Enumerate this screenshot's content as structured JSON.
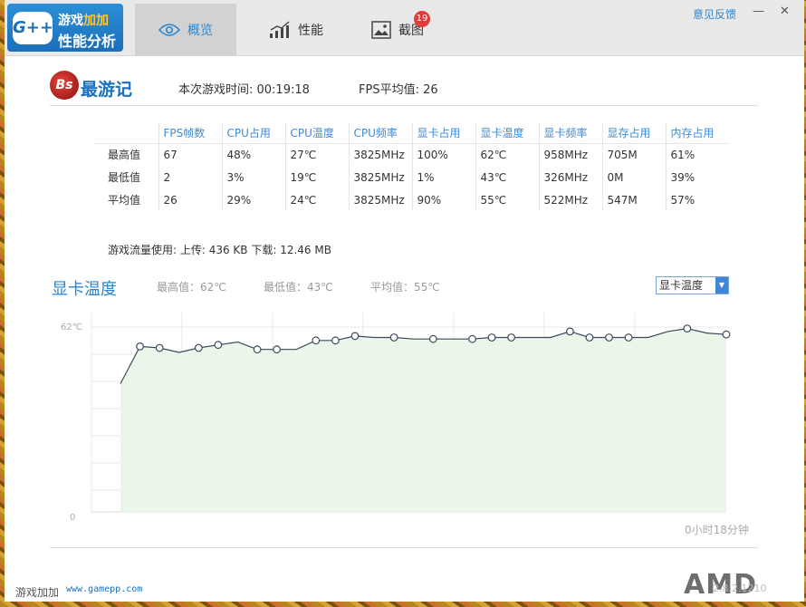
{
  "app": {
    "logo_text": "G++",
    "brand_line1_a": "游戏",
    "brand_line1_b": "加加",
    "brand_line2": "性能分析"
  },
  "tabs": [
    {
      "label": "概览",
      "icon": "eye-icon"
    },
    {
      "label": "性能",
      "icon": "performance-chart-icon"
    },
    {
      "label": "截图",
      "icon": "screenshot-image-icon",
      "badge": "19"
    }
  ],
  "header": {
    "feedback": "意见反馈",
    "minimize": "—",
    "close": "✕"
  },
  "game": {
    "logo_text": "Bs",
    "name": "最游记",
    "play_time": "本次游戏时间: 00:19:18",
    "fps_avg": "FPS平均值: 26"
  },
  "stats": {
    "columns": [
      "FPS帧数",
      "CPU占用",
      "CPU温度",
      "CPU频率",
      "显卡占用",
      "显卡温度",
      "显卡频率",
      "显存占用",
      "内存占用"
    ],
    "rows": [
      {
        "label": "最高值",
        "values": [
          "67",
          "48%",
          "27℃",
          "3825MHz",
          "100%",
          "62℃",
          "958MHz",
          "705M",
          "61%"
        ]
      },
      {
        "label": "最低值",
        "values": [
          "2",
          "3%",
          "19℃",
          "3825MHz",
          "1%",
          "43℃",
          "326MHz",
          "0M",
          "39%"
        ]
      },
      {
        "label": "平均值",
        "values": [
          "26",
          "29%",
          "24℃",
          "3825MHz",
          "90%",
          "55℃",
          "522MHz",
          "547M",
          "57%"
        ]
      }
    ]
  },
  "traffic": "游戏流量使用: 上传: 436 KB   下载: 12.46 MB",
  "chart_header": {
    "title": "显卡温度",
    "max": "最高值：62℃",
    "min": "最低值：43℃",
    "avg": "平均值：55℃",
    "select_value": "显卡温度"
  },
  "chart_data": {
    "type": "area",
    "title": "显卡温度",
    "ylabel_top": "62℃",
    "ylabel_bottom": "0",
    "xlabel_end": "0小时18分钟",
    "ylim": [
      0,
      62
    ],
    "values": [
      43,
      55.5,
      55,
      53.5,
      55,
      56,
      57,
      54.5,
      54.5,
      54.5,
      57.5,
      57.5,
      59,
      58.5,
      58.5,
      58,
      58,
      58,
      58,
      58.5,
      58.5,
      58.5,
      58.5,
      60.5,
      58.5,
      58.5,
      58.5,
      58.5,
      60.5,
      61.5,
      60,
      59.5
    ],
    "marked_points": [
      1,
      2,
      4,
      5,
      7,
      8,
      10,
      11,
      12,
      14,
      16,
      18,
      19,
      20,
      23,
      24,
      25,
      26,
      29,
      31
    ],
    "line_color": "#3b4a5c",
    "fill_color": "#eaf6ea"
  },
  "footer": {
    "name": "游戏加加",
    "url": "www.gamepp.com",
    "version": "2.8.2.1210",
    "amd_logo": "AMD"
  }
}
